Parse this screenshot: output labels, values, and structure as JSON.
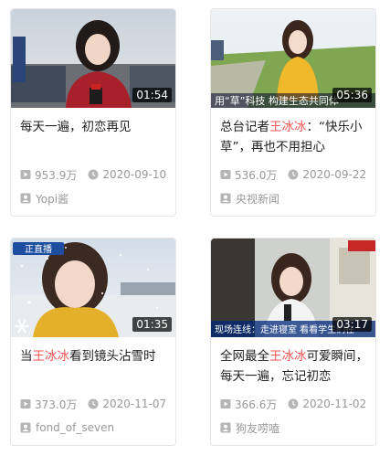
{
  "cards": [
    {
      "duration": "01:54",
      "title_parts": [
        "每天一遍，初恋再见"
      ],
      "views": "953.9万",
      "date": "2020-09-10",
      "author": "Yopi酱",
      "thumb_caption": ""
    },
    {
      "duration": "05:36",
      "title_parts": [
        "总台记者",
        "王冰冰",
        "：“快乐小草”，再也不用担心会“秃”了"
      ],
      "views": "536.0万",
      "date": "2020-09-22",
      "author": "央视新闻",
      "thumb_caption": "用“草”科技 构建生态共同体"
    },
    {
      "duration": "01:35",
      "title_parts": [
        "当",
        "王冰冰",
        "看到镜头沾雪时"
      ],
      "views": "373.0万",
      "date": "2020-11-07",
      "author": "fond_of_seven",
      "thumb_caption": "正直播"
    },
    {
      "duration": "03:17",
      "title_parts": [
        "全网最全",
        "王冰冰",
        "可爱瞬间，每天一遍，忘记初恋"
      ],
      "views": "366.6万",
      "date": "2020-11-02",
      "author": "狗友唠嗑",
      "thumb_caption": "现场连线：走进寝室 看看学生们在"
    }
  ],
  "colors": {
    "highlight": "#f05454",
    "meta": "#999999",
    "title": "#222222"
  },
  "icons": {
    "views": "play-count-icon",
    "date": "clock-icon",
    "author": "uploader-icon"
  }
}
